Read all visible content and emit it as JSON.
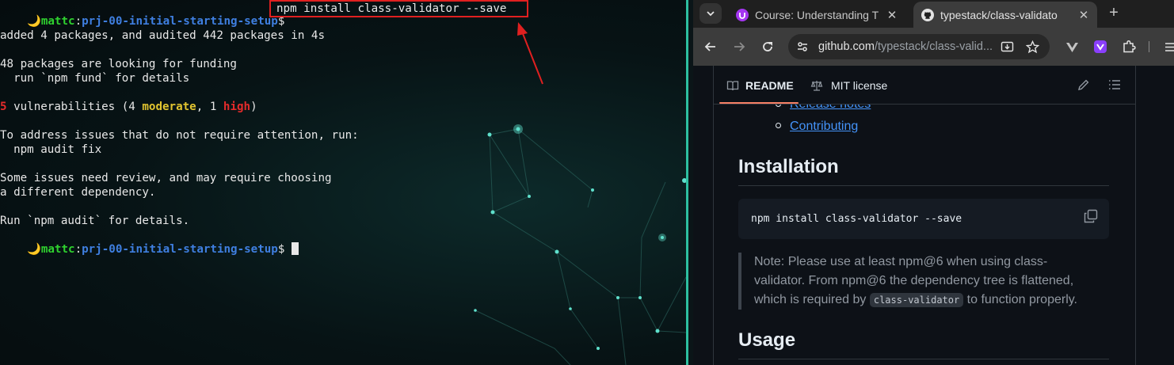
{
  "terminal": {
    "prompt": {
      "moon": "🌙",
      "user": "mattc",
      "sep": ":",
      "path": "prj-00-initial-starting-setup",
      "dollar": "$"
    },
    "command": "npm install class-validator --save",
    "lines": {
      "added": "added 4 packages, and audited 442 packages in 4s",
      "funding": "48 packages are looking for funding",
      "fund_hint": "  run `npm fund` for details",
      "vuln_count": "5",
      "vuln_text_a": " vulnerabilities (4 ",
      "vuln_moderate": "moderate",
      "vuln_text_b": ", 1 ",
      "vuln_high": "high",
      "vuln_text_c": ")",
      "address": "To address issues that do not require attention, run:",
      "audit_fix": "  npm audit fix",
      "review_1": "Some issues need review, and may require choosing",
      "review_2": "a different dependency.",
      "run_audit": "Run `npm audit` for details."
    },
    "colors": {
      "highlight_box": "#e02020",
      "arrow": "#e02020",
      "user": "#2fd12f",
      "path": "#3f7fe0"
    }
  },
  "browser": {
    "tabs": [
      {
        "title": "Course: Understanding T",
        "favicon": "udemy-icon"
      },
      {
        "title": "typestack/class-validato",
        "favicon": "github-icon"
      }
    ],
    "url": {
      "host": "github.com",
      "path": "/typestack/class-valid..."
    },
    "icons": [
      "tab-search-icon",
      "back-icon",
      "forward-icon",
      "reload-icon",
      "site-info-icon",
      "install-icon",
      "star-icon",
      "extension-icon",
      "extensions-puzzle-icon",
      "side-panel-icon",
      "profile-icon"
    ]
  },
  "readme": {
    "tabs": {
      "readme": "README",
      "license": "MIT license"
    },
    "toc_links": [
      "Release notes",
      "Contributing"
    ],
    "installation_heading": "Installation",
    "install_command": "npm install class-validator --save",
    "note_line1": "Note: Please use at least npm@6 when using class-",
    "note_line2": "validator. From npm@6 the dependency tree is flattened,",
    "note_line3_a": "which is required by ",
    "note_code": "class-validator",
    "note_line3_b": " to function properly.",
    "usage_heading": "Usage",
    "colors": {
      "link": "#4493f8",
      "tab_underline": "#f78166"
    }
  }
}
